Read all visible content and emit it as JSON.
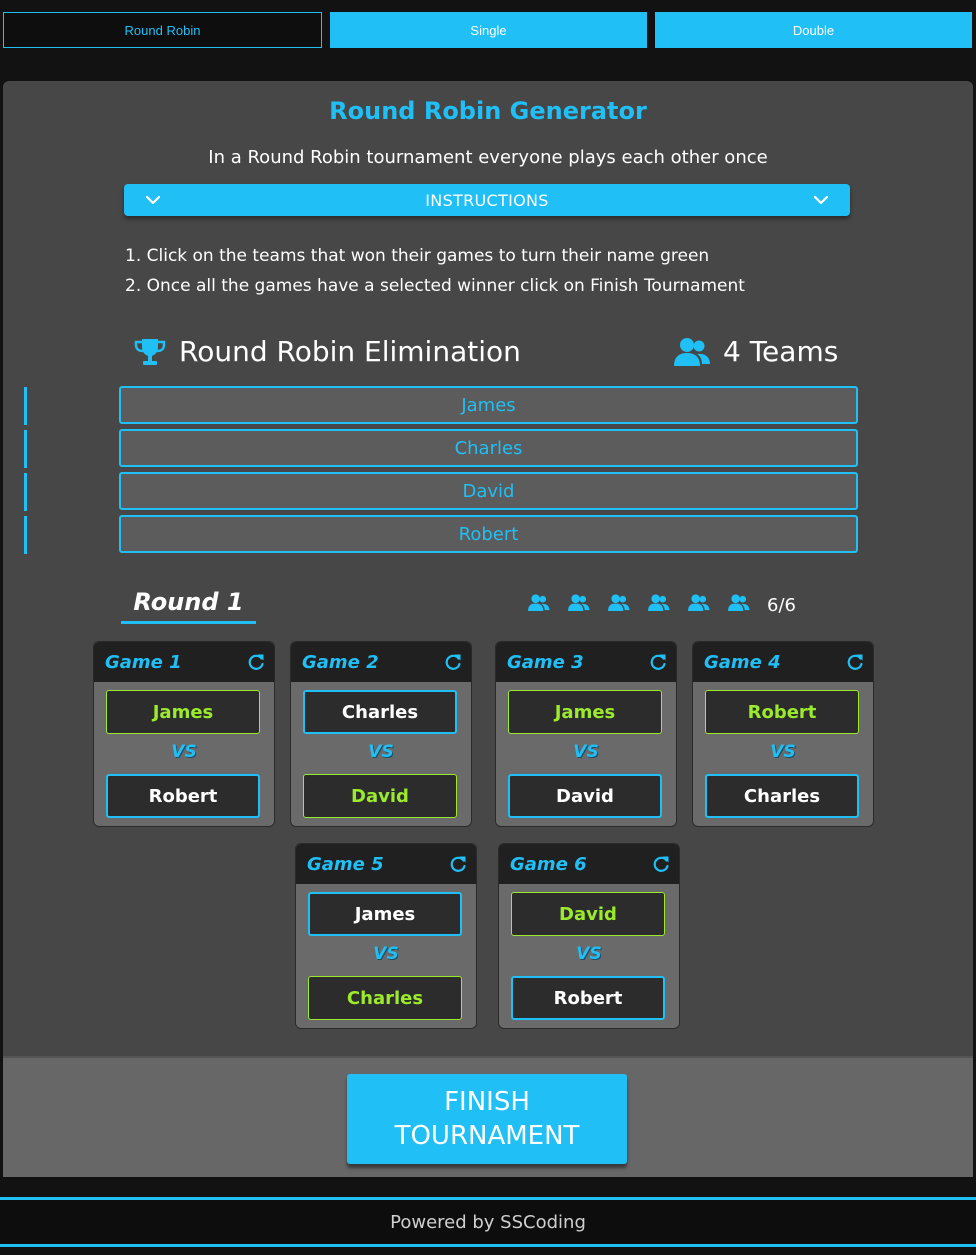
{
  "tabs": [
    {
      "label": "Round Robin",
      "active": true
    },
    {
      "label": "Single",
      "active": false
    },
    {
      "label": "Double",
      "active": false
    }
  ],
  "generator": {
    "title": "Round Robin Generator",
    "subtitle": "In a Round Robin tournament everyone plays each other once"
  },
  "instructions": {
    "label": "INSTRUCTIONS",
    "steps": [
      "1. Click on the teams that won their games to turn their name green",
      "2. Once all the games have a selected winner click on Finish Tournament"
    ]
  },
  "elimination": {
    "title": "Round Robin Elimination",
    "icon": "trophy-icon",
    "teams_label": "4 Teams",
    "teams_icon": "users-icon"
  },
  "teams": [
    "James",
    "Charles",
    "David",
    "Robert"
  ],
  "round": {
    "title": "Round 1",
    "progress": "6/6",
    "progress_icon_count": 6
  },
  "games": [
    {
      "title": "Game 1",
      "p1": "James",
      "p2": "Robert",
      "winner": 1
    },
    {
      "title": "Game 2",
      "p1": "Charles",
      "p2": "David",
      "winner": 2
    },
    {
      "title": "Game 3",
      "p1": "James",
      "p2": "David",
      "winner": 1
    },
    {
      "title": "Game 4",
      "p1": "Robert",
      "p2": "Charles",
      "winner": 1
    },
    {
      "title": "Game 5",
      "p1": "James",
      "p2": "Charles",
      "winner": 2
    },
    {
      "title": "Game 6",
      "p1": "David",
      "p2": "Robert",
      "winner": 1
    }
  ],
  "vs_label": "VS",
  "finish_label": "FINISH TOURNAMENT",
  "footer": "Powered by SSCoding",
  "colors": {
    "accent": "#20bff5",
    "winner": "#9bea2c",
    "panel": "#474747"
  }
}
